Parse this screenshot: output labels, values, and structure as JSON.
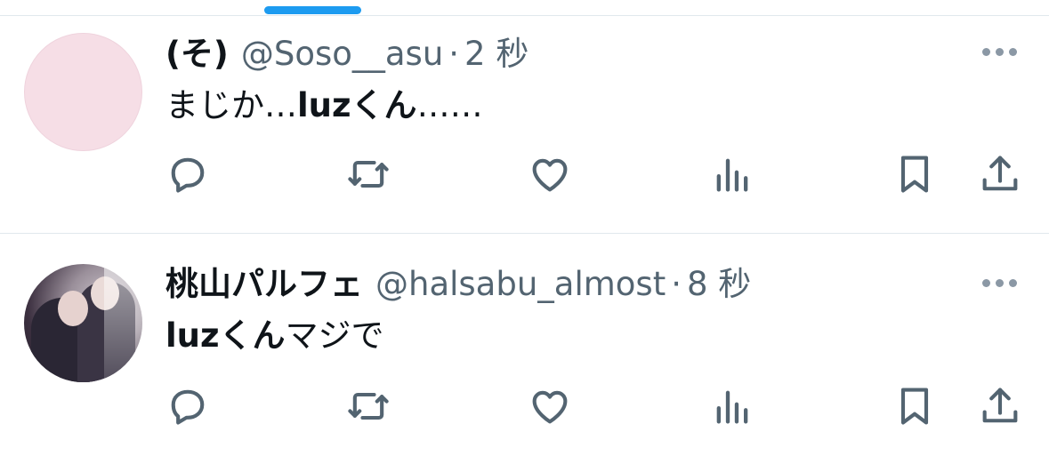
{
  "tweets": [
    {
      "display_name": "(そ)",
      "handle": "@Soso__asu",
      "separator": "·",
      "time": "2 秒",
      "body_plain_1": "まじか…",
      "body_bold": "luzくん",
      "body_plain_2": "……",
      "avatar": "pink-placeholder"
    },
    {
      "display_name": "桃山パルフェ",
      "handle": "@halsabu_almost",
      "separator": "·",
      "time": "8 秒",
      "body_plain_1": "",
      "body_bold": "luzくん",
      "body_plain_2": "マジで",
      "avatar": "photo-couple"
    }
  ],
  "icons": {
    "reply": "reply-icon",
    "retweet": "retweet-icon",
    "like": "heart-icon",
    "views": "analytics-icon",
    "bookmark": "bookmark-icon",
    "share": "share-icon",
    "more": "more-dots-icon"
  },
  "colors": {
    "accent": "#1d9bf0",
    "text_primary": "#0f1419",
    "text_secondary": "#536471",
    "icon": "#536471",
    "divider": "#e1e8ed"
  }
}
